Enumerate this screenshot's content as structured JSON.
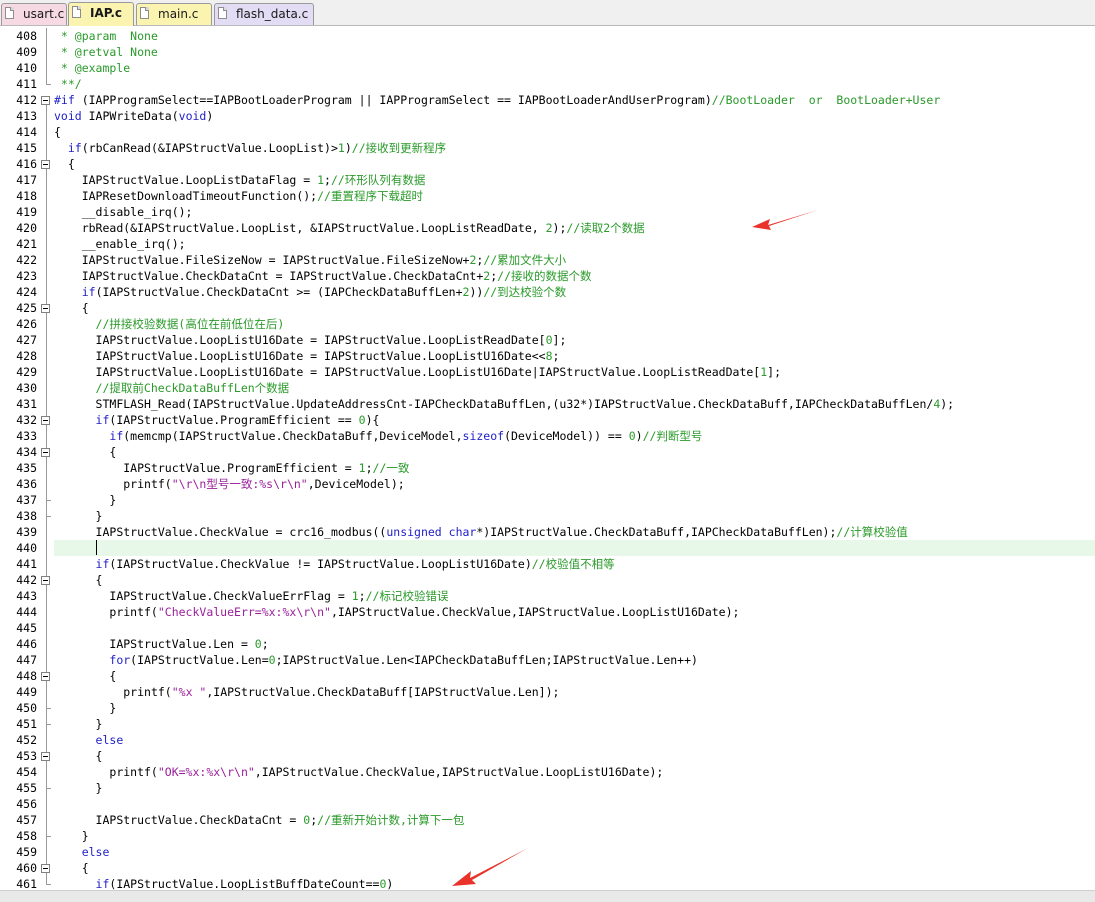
{
  "tabs": [
    {
      "label": "usart.c",
      "active": false,
      "color": "#f6d9e3"
    },
    {
      "label": "IAP.c",
      "active": true,
      "color": "#fbf3b0"
    },
    {
      "label": "main.c",
      "active": false,
      "color": "#fbf3b0"
    },
    {
      "label": "flash_data.c",
      "active": false,
      "color": "#e2dcf4"
    }
  ],
  "editor": {
    "current_line": 440,
    "lines": [
      {
        "num": "408",
        "indent": 0,
        "parts": [
          [
            " * ",
            "c"
          ],
          [
            "@param",
            "c"
          ],
          [
            "  None",
            "c"
          ]
        ]
      },
      {
        "num": "409",
        "indent": 0,
        "parts": [
          [
            " * @retval None",
            "c"
          ]
        ]
      },
      {
        "num": "410",
        "indent": 0,
        "parts": [
          [
            " * @example",
            "c"
          ]
        ]
      },
      {
        "num": "411",
        "indent": 0,
        "parts": [
          [
            " **/",
            "c"
          ]
        ]
      },
      {
        "num": "412",
        "indent": 0,
        "parts": [
          [
            "#if",
            "k"
          ],
          [
            " (IAPProgramSelect==IAPBootLoaderProgram || IAPProgramSelect == IAPBootLoaderAndUserProgram)",
            ""
          ],
          [
            "//BootLoader  or  BootLoader+User",
            "c"
          ]
        ]
      },
      {
        "num": "413",
        "indent": 0,
        "parts": [
          [
            "void",
            "k"
          ],
          [
            " IAPWriteData(",
            ""
          ],
          [
            "void",
            "k"
          ],
          [
            ")",
            ""
          ]
        ]
      },
      {
        "num": "414",
        "indent": 0,
        "parts": [
          [
            "{",
            ""
          ]
        ]
      },
      {
        "num": "415",
        "indent": 2,
        "parts": [
          [
            "if",
            "k"
          ],
          [
            "(rbCanRead(&IAPStructValue.LoopList)>",
            ""
          ],
          [
            "1",
            "n"
          ],
          [
            ")",
            ""
          ],
          [
            "//接收到更新程序",
            "c"
          ]
        ]
      },
      {
        "num": "416",
        "indent": 2,
        "parts": [
          [
            "{",
            ""
          ]
        ]
      },
      {
        "num": "417",
        "indent": 4,
        "parts": [
          [
            "IAPStructValue.LoopListDataFlag = ",
            ""
          ],
          [
            "1",
            "n"
          ],
          [
            ";",
            ""
          ],
          [
            "//环形队列有数据",
            "c"
          ]
        ]
      },
      {
        "num": "418",
        "indent": 4,
        "parts": [
          [
            "IAPResetDownloadTimeoutFunction();",
            ""
          ],
          [
            "//重置程序下载超时",
            "c"
          ]
        ]
      },
      {
        "num": "419",
        "indent": 4,
        "parts": [
          [
            "__disable_irq();",
            ""
          ]
        ]
      },
      {
        "num": "420",
        "indent": 4,
        "parts": [
          [
            "rbRead(&IAPStructValue.LoopList, &IAPStructValue.LoopListReadDate, ",
            ""
          ],
          [
            "2",
            "n"
          ],
          [
            ");",
            ""
          ],
          [
            "//读取2个数据",
            "c"
          ]
        ]
      },
      {
        "num": "421",
        "indent": 4,
        "parts": [
          [
            "__enable_irq();",
            ""
          ]
        ]
      },
      {
        "num": "422",
        "indent": 4,
        "parts": [
          [
            "IAPStructValue.FileSizeNow = IAPStructValue.FileSizeNow+",
            ""
          ],
          [
            "2",
            "n"
          ],
          [
            ";",
            ""
          ],
          [
            "//累加文件大小",
            "c"
          ]
        ]
      },
      {
        "num": "423",
        "indent": 4,
        "parts": [
          [
            "IAPStructValue.CheckDataCnt = IAPStructValue.CheckDataCnt+",
            ""
          ],
          [
            "2",
            "n"
          ],
          [
            ";",
            ""
          ],
          [
            "//接收的数据个数",
            "c"
          ]
        ]
      },
      {
        "num": "424",
        "indent": 4,
        "parts": [
          [
            "if",
            "k"
          ],
          [
            "(IAPStructValue.CheckDataCnt >= (IAPCheckDataBuffLen+",
            ""
          ],
          [
            "2",
            "n"
          ],
          [
            "))",
            ""
          ],
          [
            "//到达校验个数",
            "c"
          ]
        ]
      },
      {
        "num": "425",
        "indent": 4,
        "parts": [
          [
            "{",
            ""
          ]
        ]
      },
      {
        "num": "426",
        "indent": 6,
        "parts": [
          [
            "//拼接校验数据(高位在前低位在后)",
            "c"
          ]
        ]
      },
      {
        "num": "427",
        "indent": 6,
        "parts": [
          [
            "IAPStructValue.LoopListU16Date = IAPStructValue.LoopListReadDate[",
            ""
          ],
          [
            "0",
            "n"
          ],
          [
            "];",
            ""
          ]
        ]
      },
      {
        "num": "428",
        "indent": 6,
        "parts": [
          [
            "IAPStructValue.LoopListU16Date = IAPStructValue.LoopListU16Date<<",
            ""
          ],
          [
            "8",
            "n"
          ],
          [
            ";",
            ""
          ]
        ]
      },
      {
        "num": "429",
        "indent": 6,
        "parts": [
          [
            "IAPStructValue.LoopListU16Date = IAPStructValue.LoopListU16Date|IAPStructValue.LoopListReadDate[",
            ""
          ],
          [
            "1",
            "n"
          ],
          [
            "];",
            ""
          ]
        ]
      },
      {
        "num": "430",
        "indent": 6,
        "parts": [
          [
            "//提取前CheckDataBuffLen个数据",
            "c"
          ]
        ]
      },
      {
        "num": "431",
        "indent": 6,
        "parts": [
          [
            "STMFLASH_Read(IAPStructValue.UpdateAddressCnt-IAPCheckDataBuffLen,(u32*)IAPStructValue.CheckDataBuff,IAPCheckDataBuffLen/",
            ""
          ],
          [
            "4",
            "n"
          ],
          [
            ");",
            ""
          ]
        ]
      },
      {
        "num": "432",
        "indent": 6,
        "parts": [
          [
            "if",
            "k"
          ],
          [
            "(IAPStructValue.ProgramEfficient == ",
            ""
          ],
          [
            "0",
            "n"
          ],
          [
            "){",
            ""
          ]
        ]
      },
      {
        "num": "433",
        "indent": 8,
        "parts": [
          [
            "if",
            "k"
          ],
          [
            "(memcmp(IAPStructValue.CheckDataBuff,DeviceModel,",
            ""
          ],
          [
            "sizeof",
            "k"
          ],
          [
            "(DeviceModel)) == ",
            ""
          ],
          [
            "0",
            "n"
          ],
          [
            ")",
            ""
          ],
          [
            "//判断型号",
            "c"
          ]
        ]
      },
      {
        "num": "434",
        "indent": 8,
        "parts": [
          [
            "{",
            ""
          ]
        ]
      },
      {
        "num": "435",
        "indent": 10,
        "parts": [
          [
            "IAPStructValue.ProgramEfficient = ",
            ""
          ],
          [
            "1",
            "n"
          ],
          [
            ";",
            ""
          ],
          [
            "//一致",
            "c"
          ]
        ]
      },
      {
        "num": "436",
        "indent": 10,
        "parts": [
          [
            "printf(",
            ""
          ],
          [
            "\"\\r\\n型号一致:%s\\r\\n\"",
            "s"
          ],
          [
            ",DeviceModel);",
            ""
          ]
        ]
      },
      {
        "num": "437",
        "indent": 8,
        "parts": [
          [
            "}",
            ""
          ]
        ]
      },
      {
        "num": "438",
        "indent": 6,
        "parts": [
          [
            "}",
            ""
          ]
        ]
      },
      {
        "num": "439",
        "indent": 6,
        "parts": [
          [
            "IAPStructValue.CheckValue = crc16_modbus((",
            ""
          ],
          [
            "unsigned char",
            "k"
          ],
          [
            "*)IAPStructValue.CheckDataBuff,IAPCheckDataBuffLen);",
            ""
          ],
          [
            "//计算校验值",
            "c"
          ]
        ]
      },
      {
        "num": "440",
        "indent": 6,
        "parts": []
      },
      {
        "num": "441",
        "indent": 6,
        "parts": [
          [
            "if",
            "k"
          ],
          [
            "(IAPStructValue.CheckValue != IAPStructValue.LoopListU16Date)",
            ""
          ],
          [
            "//校验值不相等",
            "c"
          ]
        ]
      },
      {
        "num": "442",
        "indent": 6,
        "parts": [
          [
            "{",
            ""
          ]
        ]
      },
      {
        "num": "443",
        "indent": 8,
        "parts": [
          [
            "IAPStructValue.CheckValueErrFlag = ",
            ""
          ],
          [
            "1",
            "n"
          ],
          [
            ";",
            ""
          ],
          [
            "//标记校验错误",
            "c"
          ]
        ]
      },
      {
        "num": "444",
        "indent": 8,
        "parts": [
          [
            "printf(",
            ""
          ],
          [
            "\"CheckValueErr=%x:%x\\r\\n\"",
            "s"
          ],
          [
            ",IAPStructValue.CheckValue,IAPStructValue.LoopListU16Date);",
            ""
          ]
        ]
      },
      {
        "num": "445",
        "indent": 8,
        "parts": []
      },
      {
        "num": "446",
        "indent": 8,
        "parts": [
          [
            "IAPStructValue.Len = ",
            ""
          ],
          [
            "0",
            "n"
          ],
          [
            ";",
            ""
          ]
        ]
      },
      {
        "num": "447",
        "indent": 8,
        "parts": [
          [
            "for",
            "k"
          ],
          [
            "(IAPStructValue.Len=",
            ""
          ],
          [
            "0",
            "n"
          ],
          [
            ";IAPStructValue.Len<IAPCheckDataBuffLen;IAPStructValue.Len++)",
            ""
          ]
        ]
      },
      {
        "num": "448",
        "indent": 8,
        "parts": [
          [
            "{",
            ""
          ]
        ]
      },
      {
        "num": "449",
        "indent": 10,
        "parts": [
          [
            "printf(",
            ""
          ],
          [
            "\"%x \"",
            "s"
          ],
          [
            ",IAPStructValue.CheckDataBuff[IAPStructValue.Len]);",
            ""
          ]
        ]
      },
      {
        "num": "450",
        "indent": 8,
        "parts": [
          [
            "}",
            ""
          ]
        ]
      },
      {
        "num": "451",
        "indent": 6,
        "parts": [
          [
            "}",
            ""
          ]
        ]
      },
      {
        "num": "452",
        "indent": 6,
        "parts": [
          [
            "else",
            "k"
          ]
        ]
      },
      {
        "num": "453",
        "indent": 6,
        "parts": [
          [
            "{",
            ""
          ]
        ]
      },
      {
        "num": "454",
        "indent": 8,
        "parts": [
          [
            "printf(",
            ""
          ],
          [
            "\"OK=%x:%x\\r\\n\"",
            "s"
          ],
          [
            ",IAPStructValue.CheckValue,IAPStructValue.LoopListU16Date);",
            ""
          ]
        ]
      },
      {
        "num": "455",
        "indent": 6,
        "parts": [
          [
            "}",
            ""
          ]
        ]
      },
      {
        "num": "456",
        "indent": 6,
        "parts": []
      },
      {
        "num": "457",
        "indent": 6,
        "parts": [
          [
            "IAPStructValue.CheckDataCnt = ",
            ""
          ],
          [
            "0",
            "n"
          ],
          [
            ";",
            ""
          ],
          [
            "//重新开始计数,计算下一包",
            "c"
          ]
        ]
      },
      {
        "num": "458",
        "indent": 4,
        "parts": [
          [
            "}",
            ""
          ]
        ]
      },
      {
        "num": "459",
        "indent": 4,
        "parts": [
          [
            "else",
            "k"
          ]
        ]
      },
      {
        "num": "460",
        "indent": 4,
        "parts": [
          [
            "{",
            ""
          ]
        ]
      },
      {
        "num": "461",
        "indent": 6,
        "parts": [
          [
            "if",
            "k"
          ],
          [
            "(IAPStructValue.LoopListBuffDateCount==",
            ""
          ],
          [
            "0",
            "n"
          ],
          [
            ")",
            ""
          ]
        ]
      }
    ]
  },
  "annotation_color": "#e8322a",
  "icons": [
    "file-icon",
    "fold-toggle-icon",
    "red-arrow-annotation"
  ]
}
